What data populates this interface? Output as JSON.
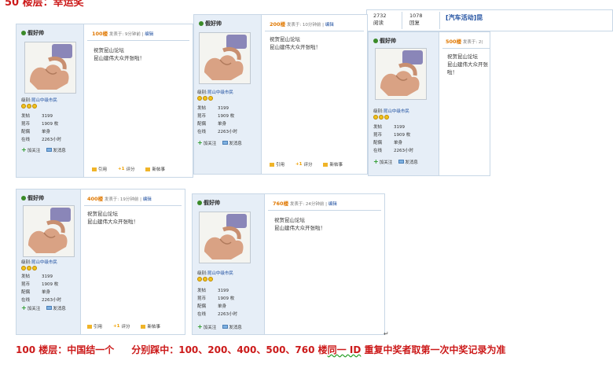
{
  "heading": "50 楼层：幸运奖",
  "stats": {
    "views": "2732",
    "views_label": "阅读",
    "replies": "1078",
    "replies_label": "回复",
    "thread_title": "[汽车活动]昆"
  },
  "user": {
    "name": "假好帅",
    "rank_label": "级别:",
    "rank_value": "昆山中级市民",
    "rows": [
      {
        "k": "发帖",
        "v": "3199"
      },
      {
        "k": "昆币",
        "v": "1909 枚"
      },
      {
        "k": "配偶",
        "v": "单身"
      },
      {
        "k": "在线",
        "v": "2263小时"
      }
    ],
    "follow": "加关注",
    "message": "发消息"
  },
  "post": {
    "line1": "祝贺昆山论坛",
    "line2": "昆山建伟大众开张啦！",
    "edit": "编辑",
    "quote": "引用",
    "score": "+1",
    "score_label": "评分",
    "newpost": "新帖事"
  },
  "posts": [
    {
      "floor": "100楼",
      "time": "发表于: 9分钟前 |"
    },
    {
      "floor": "200楼",
      "time": "发表于: 10分钟前 |"
    },
    {
      "floor": "500楼",
      "time": "发表于: 2("
    },
    {
      "floor": "400楼",
      "time": "发表于: 19分钟前 |"
    },
    {
      "floor": "760楼",
      "time": "发表于: 24分钟前 |"
    }
  ],
  "bottom": {
    "part1": "100 楼层：中国结一个",
    "part2": "分别踩中：100、200、400、500、760 楼",
    "part3": "同一 ID",
    "part4": "重复中奖者取第一次中奖记录为准"
  },
  "colors": {
    "accent": "#cc1a1a",
    "link": "#1f4fa0",
    "floor": "#e07800",
    "sidebar_bg": "#e6eef7",
    "border": "#c8d7e6"
  }
}
